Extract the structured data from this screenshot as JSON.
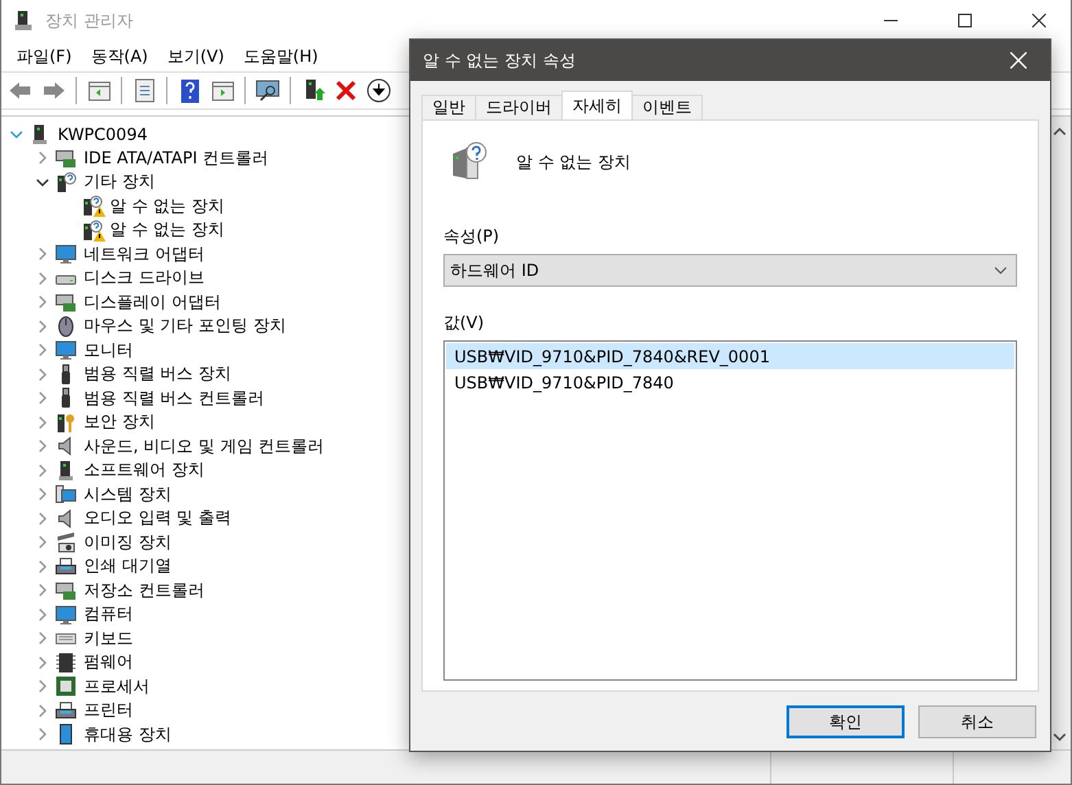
{
  "window": {
    "title": "장치 관리자"
  },
  "menu": [
    "파일(F)",
    "동작(A)",
    "보기(V)",
    "도움말(H)"
  ],
  "tree": [
    {
      "label": "KWPC0094",
      "expanded": true,
      "children": [
        {
          "label": "IDE ATA/ATAPI 컨트롤러",
          "expanded": false
        },
        {
          "label": "기타 장치",
          "expanded": true,
          "children": [
            {
              "label": "알 수 없는 장치",
              "warning": true
            },
            {
              "label": "알 수 없는 장치",
              "warning": true
            }
          ]
        },
        {
          "label": "네트워크 어댑터",
          "expanded": false
        },
        {
          "label": "디스크 드라이브",
          "expanded": false
        },
        {
          "label": "디스플레이 어댑터",
          "expanded": false
        },
        {
          "label": "마우스 및 기타 포인팅 장치",
          "expanded": false
        },
        {
          "label": "모니터",
          "expanded": false
        },
        {
          "label": "범용 직렬 버스 장치",
          "expanded": false
        },
        {
          "label": "범용 직렬 버스 컨트롤러",
          "expanded": false
        },
        {
          "label": "보안 장치",
          "expanded": false
        },
        {
          "label": "사운드, 비디오 및 게임 컨트롤러",
          "expanded": false
        },
        {
          "label": "소프트웨어 장치",
          "expanded": false
        },
        {
          "label": "시스템 장치",
          "expanded": false
        },
        {
          "label": "오디오 입력 및 출력",
          "expanded": false
        },
        {
          "label": "이미징 장치",
          "expanded": false
        },
        {
          "label": "인쇄 대기열",
          "expanded": false
        },
        {
          "label": "저장소 컨트롤러",
          "expanded": false
        },
        {
          "label": "컴퓨터",
          "expanded": false
        },
        {
          "label": "키보드",
          "expanded": false
        },
        {
          "label": "펌웨어",
          "expanded": false
        },
        {
          "label": "프로세서",
          "expanded": false
        },
        {
          "label": "프린터",
          "expanded": false
        },
        {
          "label": "휴대용 장치",
          "expanded": false
        }
      ]
    }
  ],
  "dialog": {
    "title": "알 수 없는 장치 속성",
    "tabs": [
      {
        "label": "일반",
        "selected": false
      },
      {
        "label": "드라이버",
        "selected": false
      },
      {
        "label": "자세히",
        "selected": true
      },
      {
        "label": "이벤트",
        "selected": false
      }
    ],
    "device_name": "알 수 없는 장치",
    "property_label": "속성(P)",
    "property": "하드웨어 ID",
    "value_label": "값(V)",
    "values": [
      {
        "text": "USB₩VID_9710&PID_7840&REV_0001",
        "selected": true
      },
      {
        "text": "USB₩VID_9710&PID_7840",
        "selected": false
      }
    ],
    "buttons": [
      {
        "label": "확인",
        "default": true
      },
      {
        "label": "취소",
        "default": false
      }
    ]
  }
}
